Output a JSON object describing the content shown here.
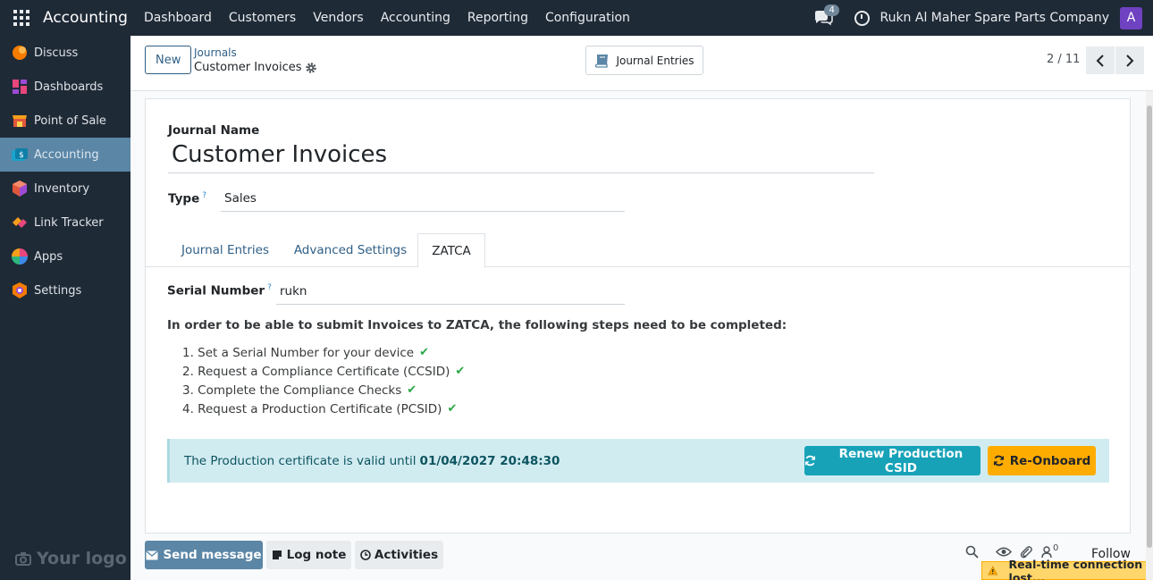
{
  "topbar": {
    "app_title": "Accounting",
    "menu": [
      "Dashboard",
      "Customers",
      "Vendors",
      "Accounting",
      "Reporting",
      "Configuration"
    ],
    "messages_count": "4",
    "company": "Rukn Al Maher Spare Parts Company",
    "avatar_letter": "A"
  },
  "sidebar": {
    "items": [
      {
        "label": "Discuss",
        "icon": "discuss-icon",
        "color": "#f57c00"
      },
      {
        "label": "Dashboards",
        "icon": "dashboards-icon",
        "color": "#e8467c"
      },
      {
        "label": "Point of Sale",
        "icon": "point-of-sale-icon",
        "color": "#f59f1b"
      },
      {
        "label": "Accounting",
        "icon": "accounting-icon",
        "color": "#1aa3cc"
      },
      {
        "label": "Inventory",
        "icon": "inventory-icon",
        "color": "#e0573c"
      },
      {
        "label": "Link Tracker",
        "icon": "link-tracker-icon",
        "color": "#e8467c"
      },
      {
        "label": "Apps",
        "icon": "apps-icon",
        "color": "#3d8be8"
      },
      {
        "label": "Settings",
        "icon": "settings-icon",
        "color": "#f57c00"
      }
    ],
    "active_index": 3,
    "logo_text": "Your logo"
  },
  "control": {
    "new_label": "New",
    "breadcrumb_parent": "Journals",
    "breadcrumb_current": "Customer Invoices",
    "journal_entries_label": "Journal Entries",
    "pager": "2 / 11"
  },
  "form": {
    "journal_name_label": "Journal Name",
    "journal_name": "Customer Invoices",
    "type_label": "Type",
    "type_value": "Sales",
    "help_mark": "?",
    "tabs": [
      "Journal Entries",
      "Advanced Settings",
      "ZATCA"
    ],
    "active_tab": 2,
    "serial_label": "Serial Number",
    "serial_value": "rukn",
    "instructions": "In order to be able to submit Invoices to ZATCA, the following steps need to be completed:",
    "steps": [
      "1. Set a Serial Number for your device",
      "2. Request a Compliance Certificate (CCSID)",
      "3. Complete the Compliance Checks",
      "4. Request a Production Certificate (PCSID)"
    ],
    "alert_text": "The Production certificate is valid until",
    "alert_date": "01/04/2027 20:48:30",
    "renew_label": "Renew Production CSID",
    "reonboard_label": "Re-Onboard"
  },
  "chatter": {
    "send_label": "Send message",
    "log_label": "Log note",
    "activities_label": "Activities",
    "followers_count": "0",
    "follow_label": "Follow",
    "toast": "Real-time connection lost..."
  }
}
